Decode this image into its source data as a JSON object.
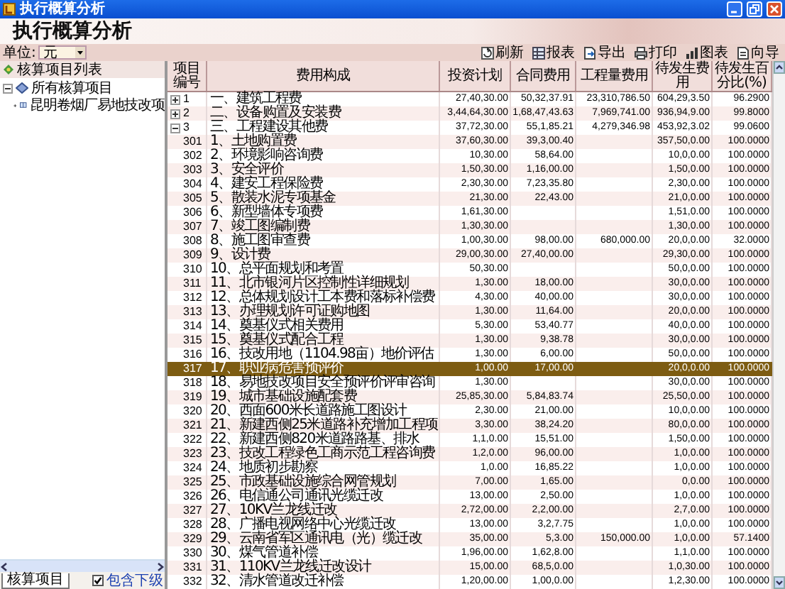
{
  "window": {
    "title": "执行概算分析"
  },
  "header": {
    "title": "执行概算分析"
  },
  "toolbar": {
    "unit_label": "单位:",
    "unit_value": "元",
    "buttons": [
      {
        "label": "刷新",
        "kind": "refresh"
      },
      {
        "label": "报表",
        "kind": "report"
      },
      {
        "label": "导出",
        "kind": "export"
      },
      {
        "label": "打印",
        "kind": "print"
      },
      {
        "label": "图表",
        "kind": "chart"
      },
      {
        "label": "向导",
        "kind": "wizard"
      }
    ]
  },
  "sidebar": {
    "title": "核算项目列表",
    "tree": [
      {
        "label": "所有核算项目",
        "expanded": true,
        "children": [
          {
            "label": "昆明卷烟厂易地技改项",
            "expanded": false
          }
        ]
      }
    ],
    "tab": "核算项目",
    "include_sub": {
      "label": "包含下级",
      "checked": true
    }
  },
  "table": {
    "columns": [
      "项目编号",
      "费用构成",
      "投资计划",
      "合同费用",
      "工程量费用",
      "待发生费用",
      "待发生百分比(%)"
    ],
    "rows": [
      {
        "kind": "group",
        "expanded": false,
        "selected": false,
        "code": "1",
        "name": "一、建筑工程费",
        "invest": "27,40,30.00",
        "contract": "50,32,37.91",
        "quantity": "23,310,786.50",
        "pending": "604,29,3.50",
        "percent": "96.2900"
      },
      {
        "kind": "group",
        "expanded": false,
        "selected": false,
        "code": "2",
        "name": "二、设备购置及安装费",
        "invest": "3,44,64,30.00",
        "contract": "1,68,47,43.63",
        "quantity": "7,969,741.00",
        "pending": "936,94,9.00",
        "percent": "99.8000"
      },
      {
        "kind": "group",
        "expanded": true,
        "selected": false,
        "code": "3",
        "name": "三、工程建设其他费",
        "invest": "37,72,30.00",
        "contract": "55,1,85.21",
        "quantity": "4,279,346.98",
        "pending": "453,92,3.02",
        "percent": "99.0600"
      },
      {
        "kind": "item",
        "selected": false,
        "code": "301",
        "name": "1、土地购置费",
        "invest": "37,60,30.00",
        "contract": "39,3,00.40",
        "pending": "357,50,0.00",
        "percent": "100.0000"
      },
      {
        "kind": "item",
        "selected": false,
        "code": "302",
        "name": "2、环境影响咨询费",
        "invest": "10,30.00",
        "contract": "58,64.00",
        "pending": "10,0,0.00",
        "percent": "100.0000"
      },
      {
        "kind": "item",
        "selected": false,
        "code": "303",
        "name": "3、安全评价",
        "invest": "1,50,30.00",
        "contract": "1,16,00.00",
        "pending": "1,50,0.00",
        "percent": "100.0000"
      },
      {
        "kind": "item",
        "selected": false,
        "code": "304",
        "name": "4、建安工程保险费",
        "invest": "2,30,30.00",
        "contract": "7,23,35.80",
        "pending": "2,30,0.00",
        "percent": "100.0000"
      },
      {
        "kind": "item",
        "selected": false,
        "code": "305",
        "name": "5、散装水泥专项基金",
        "invest": "21,30.00",
        "contract": "22,43.00",
        "pending": "21,0,0.00",
        "percent": "100.0000"
      },
      {
        "kind": "item",
        "selected": false,
        "code": "306",
        "name": "6、新型墙体专项费",
        "invest": "1,61,30.00",
        "pending": "1,51,0.00",
        "percent": "100.0000"
      },
      {
        "kind": "item",
        "selected": false,
        "code": "307",
        "name": "7、竣工图编制费",
        "invest": "1,30,30.00",
        "pending": "1,30,0.00",
        "percent": "100.0000"
      },
      {
        "kind": "item",
        "selected": false,
        "code": "308",
        "name": "8、施工图审查费",
        "invest": "1,00,30.00",
        "contract": "98,00.00",
        "quantity": "680,000.00",
        "pending": "20,0,0.00",
        "percent": "32.0000"
      },
      {
        "kind": "item",
        "selected": false,
        "code": "309",
        "name": "9、设计费",
        "invest": "29,00,30.00",
        "contract": "27,40,00.00",
        "pending": "29,30,0.00",
        "percent": "100.0000"
      },
      {
        "kind": "item",
        "selected": false,
        "code": "310",
        "name": "10、总平面规划和考置",
        "invest": "50,30.00",
        "pending": "50,0,0.00",
        "percent": "100.0000"
      },
      {
        "kind": "item",
        "selected": false,
        "code": "311",
        "name": "11、北市银河片区控制性详细规划",
        "invest": "1,30.00",
        "contract": "18,00.00",
        "pending": "30,0,0.00",
        "percent": "100.0000"
      },
      {
        "kind": "item",
        "selected": false,
        "code": "312",
        "name": "12、总体规划设计工本费和落标补偿费",
        "invest": "4,30.00",
        "contract": "40,00.00",
        "pending": "30,0,0.00",
        "percent": "100.0000"
      },
      {
        "kind": "item",
        "selected": false,
        "code": "313",
        "name": "13、办理规划许可证购地图",
        "invest": "1,30.00",
        "contract": "11,64.00",
        "pending": "20,0,0.00",
        "percent": "100.0000"
      },
      {
        "kind": "item",
        "selected": false,
        "code": "314",
        "name": "14、奠基仪式相关费用",
        "invest": "5,30.00",
        "contract": "53,40.77",
        "pending": "40,0,0.00",
        "percent": "100.0000"
      },
      {
        "kind": "item",
        "selected": false,
        "code": "315",
        "name": "15、奠基仪式配合工程",
        "invest": "1,30.00",
        "contract": "9,38.78",
        "pending": "30,0,0.00",
        "percent": "100.0000"
      },
      {
        "kind": "item",
        "selected": false,
        "code": "316",
        "name": "16、技改用地（1104.98亩）地价评估",
        "invest": "1,30.00",
        "contract": "6,00.00",
        "pending": "50,0,0.00",
        "percent": "100.0000"
      },
      {
        "kind": "item",
        "selected": true,
        "code": "317",
        "name": "17、职业病危害预评价",
        "invest": "1,00.00",
        "contract": "17,00.00",
        "pending": "20,0,0.00",
        "percent": "100.0000"
      },
      {
        "kind": "item",
        "selected": false,
        "code": "318",
        "name": "18、易地技改项目安全预评价评审咨询",
        "invest": "1,30.00",
        "pending": "30,0,0.00",
        "percent": "100.0000"
      },
      {
        "kind": "item",
        "selected": false,
        "code": "319",
        "name": "19、城市基础设施配套费",
        "invest": "25,85,30.00",
        "contract": "5,84,83.74",
        "pending": "25,50,0.00",
        "percent": "100.0000"
      },
      {
        "kind": "item",
        "selected": false,
        "code": "320",
        "name": "20、西面600米长道路施工图设计",
        "invest": "2,30.00",
        "contract": "21,00.00",
        "pending": "10,0,0.00",
        "percent": "100.0000"
      },
      {
        "kind": "item",
        "selected": false,
        "code": "321",
        "name": "21、新建西侧25米道路补充增加工程项",
        "invest": "3,30.00",
        "contract": "38,24.20",
        "pending": "80,0,0.00",
        "percent": "100.0000"
      },
      {
        "kind": "item",
        "selected": false,
        "code": "322",
        "name": "22、新建西侧820米道路路基、排水",
        "invest": "1,1,0.00",
        "contract": "15,51.00",
        "pending": "1,50,0.00",
        "percent": "100.0000"
      },
      {
        "kind": "item",
        "selected": false,
        "code": "323",
        "name": "23、技改工程绿色工商示范工程咨询费",
        "invest": "1,2,0.00",
        "contract": "96,00.00",
        "pending": "1,0,0.00",
        "percent": "100.0000"
      },
      {
        "kind": "item",
        "selected": false,
        "code": "324",
        "name": "24、地质初步勘察",
        "invest": "1,0.00",
        "contract": "16,85.22",
        "pending": "1,0,0.00",
        "percent": "100.0000"
      },
      {
        "kind": "item",
        "selected": false,
        "code": "325",
        "name": "25、市政基础设施综合网管规划",
        "invest": "7,00.00",
        "contract": "1,65.00",
        "pending": "0,0.00",
        "percent": "100.0000"
      },
      {
        "kind": "item",
        "selected": false,
        "code": "326",
        "name": "26、电信通公司通讯光缆迁改",
        "invest": "13,00.00",
        "contract": "2,50.00",
        "pending": "1,0,0.00",
        "percent": "100.0000"
      },
      {
        "kind": "item",
        "selected": false,
        "code": "327",
        "name": "27、10KV兰龙线迁改",
        "invest": "2,72,00.00",
        "contract": "2,2,00.00",
        "pending": "2,7,0.00",
        "percent": "100.0000"
      },
      {
        "kind": "item",
        "selected": false,
        "code": "328",
        "name": "28、广播电视网络中心光缆迁改",
        "invest": "13,00.00",
        "contract": "3,2,7.75",
        "pending": "1,0,0.00",
        "percent": "100.0000"
      },
      {
        "kind": "item",
        "selected": false,
        "code": "329",
        "name": "29、云南省军区通讯电（光）缆迁改",
        "invest": "35,00.00",
        "contract": "5,3.00",
        "quantity": "150,000.00",
        "pending": "1,0,0.00",
        "percent": "57.1400"
      },
      {
        "kind": "item",
        "selected": false,
        "code": "330",
        "name": "30、煤气管道补偿",
        "invest": "1,96,00.00",
        "contract": "1,62,8.00",
        "pending": "1,1,0.00",
        "percent": "100.0000"
      },
      {
        "kind": "item",
        "selected": false,
        "code": "331",
        "name": "31、110KV兰龙线迁改设计",
        "invest": "15,00.00",
        "contract": "68,5,0.00",
        "pending": "1,0,30.00",
        "percent": "100.0000"
      },
      {
        "kind": "item",
        "selected": false,
        "code": "332",
        "name": "32、清水管道改迁补偿",
        "invest": "1,20,00.00",
        "contract": "1,00,0.00",
        "pending": "1,2,30.00",
        "percent": "100.0000"
      }
    ]
  }
}
